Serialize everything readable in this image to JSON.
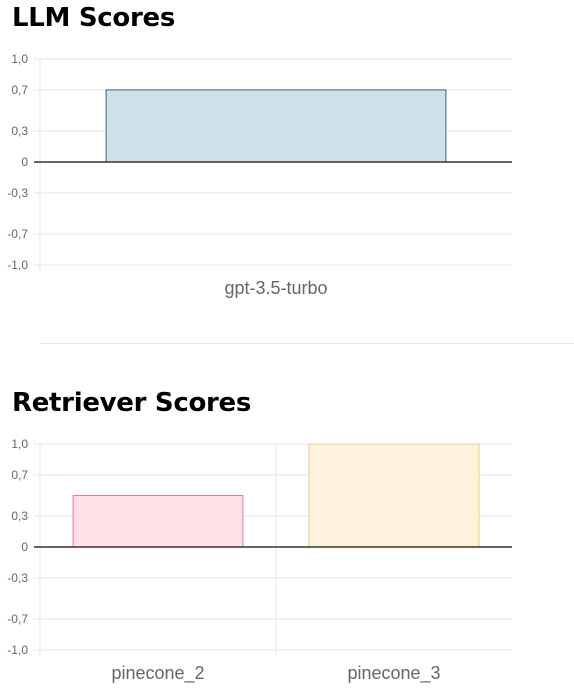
{
  "charts": {
    "llm": {
      "title": "LLM Scores"
    },
    "retriever": {
      "title": "Retriever Scores"
    }
  },
  "chart_data": [
    {
      "type": "bar",
      "title": "LLM Scores",
      "categories": [
        "gpt-3.5-turbo"
      ],
      "values": [
        0.7
      ],
      "ylim": [
        -1.0,
        1.0
      ],
      "yticks": [
        1.0,
        0.7,
        0.3,
        0,
        -0.3,
        -0.7,
        -1.0
      ],
      "ytick_labels": [
        "1,0",
        "0,7",
        "0,3",
        "0",
        "-0,3",
        "-0,7",
        "-1,0"
      ],
      "bar_fill": [
        "#cfe1e8"
      ],
      "bar_stroke": [
        "#2e6e7a"
      ],
      "grid": true,
      "xlabel": "",
      "ylabel": ""
    },
    {
      "type": "bar",
      "title": "Retriever Scores",
      "categories": [
        "pinecone_2",
        "pinecone_3"
      ],
      "values": [
        0.5,
        1.0
      ],
      "ylim": [
        -1.0,
        1.0
      ],
      "yticks": [
        1.0,
        0.7,
        0.3,
        0,
        -0.3,
        -0.7,
        -1.0
      ],
      "ytick_labels": [
        "1,0",
        "0,7",
        "0,3",
        "0",
        "-0,3",
        "-0,7",
        "-1,0"
      ],
      "bar_fill": [
        "#ffe0e6",
        "#fdf3dc"
      ],
      "bar_stroke": [
        "#e87a96",
        "#eec983"
      ],
      "grid": true,
      "xlabel": "",
      "ylabel": ""
    }
  ],
  "colors": {
    "grid": "#e5e5e5",
    "zero_line": "#333333",
    "axis_text": "#666666"
  }
}
